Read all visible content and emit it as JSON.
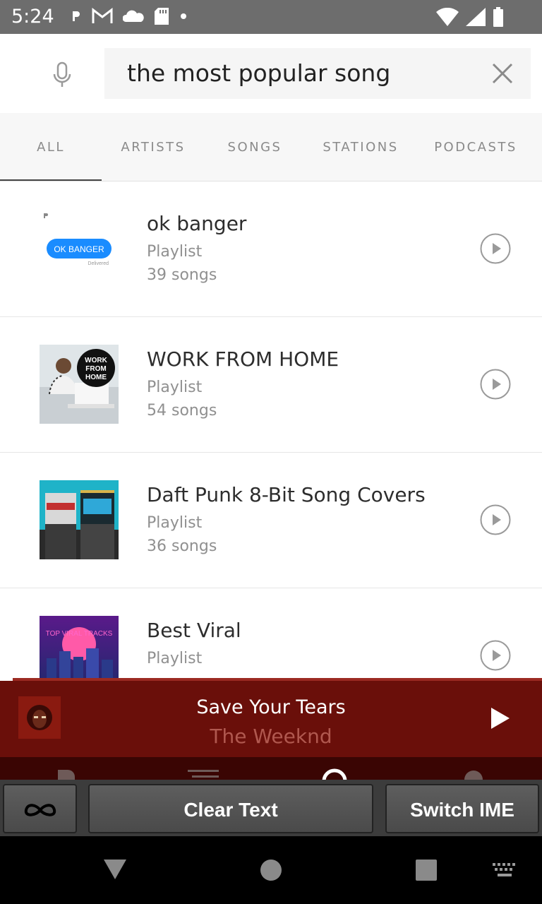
{
  "status_bar": {
    "time": "5:24"
  },
  "search": {
    "query": "the most popular song"
  },
  "tabs": [
    {
      "label": "ALL",
      "selected": true
    },
    {
      "label": "ARTISTS",
      "selected": false
    },
    {
      "label": "SONGS",
      "selected": false
    },
    {
      "label": "STATIONS",
      "selected": false
    },
    {
      "label": "PODCASTS",
      "selected": false
    }
  ],
  "results": [
    {
      "title": "ok banger",
      "type": "Playlist",
      "count": "39 songs",
      "art_text": "OK BANGER",
      "art_subtext": "Delivered"
    },
    {
      "title": "WORK FROM HOME",
      "type": "Playlist",
      "count": "54 songs",
      "art_text": "WORK FROM HOME"
    },
    {
      "title": "Daft Punk 8-Bit Song Covers",
      "type": "Playlist",
      "count": "36 songs"
    },
    {
      "title": "Best Viral",
      "type": "Playlist",
      "count": "",
      "art_text": "TOP VIRAL TRACKS"
    }
  ],
  "now_playing": {
    "title": "Save Your Tears",
    "artist": "The Weeknd"
  },
  "ime_bar": {
    "clear_label": "Clear Text",
    "switch_label": "Switch IME"
  },
  "colors": {
    "player_bg": "#6a0f0a",
    "status_bar": "#6d6d6d",
    "artist_text": "#b0584f"
  }
}
